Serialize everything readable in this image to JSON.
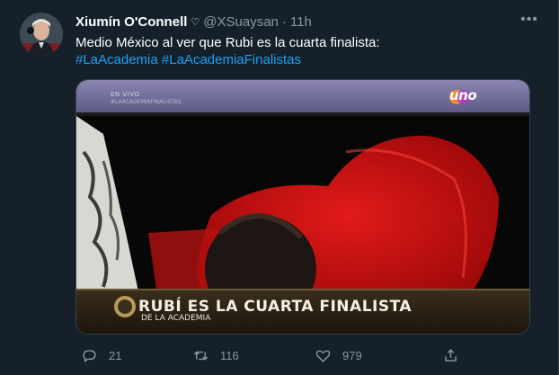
{
  "tweet": {
    "display_name": "Xiumín O'Connell",
    "name_icon": "heart-outline-icon",
    "handle": "@XSuaysan",
    "separator": "·",
    "time": "11h",
    "more_icon": "more-horizontal-icon",
    "text": "Medio México al ver que Rubi es la cuarta finalista:",
    "hashtags": [
      "#LaAcademia",
      "#LaAcademiaFinalistas"
    ]
  },
  "media": {
    "live_label": "EN VIVO",
    "live_hashtag": "#LAACADEMIAFINALISTAS",
    "channel_logo": "uno",
    "caption": "RUBÍ ES LA CUARTA FINALISTA",
    "caption_sub": "DE LA ACADEMIA"
  },
  "actions": {
    "reply": {
      "icon": "reply-icon",
      "count": "21"
    },
    "retweet": {
      "icon": "retweet-icon",
      "count": "116"
    },
    "like": {
      "icon": "heart-icon",
      "count": "979"
    },
    "share": {
      "icon": "share-icon"
    }
  },
  "colors": {
    "background": "#15202b",
    "text": "#ffffff",
    "secondary": "#8899a6",
    "link": "#1da1f2",
    "border": "#38444d"
  }
}
